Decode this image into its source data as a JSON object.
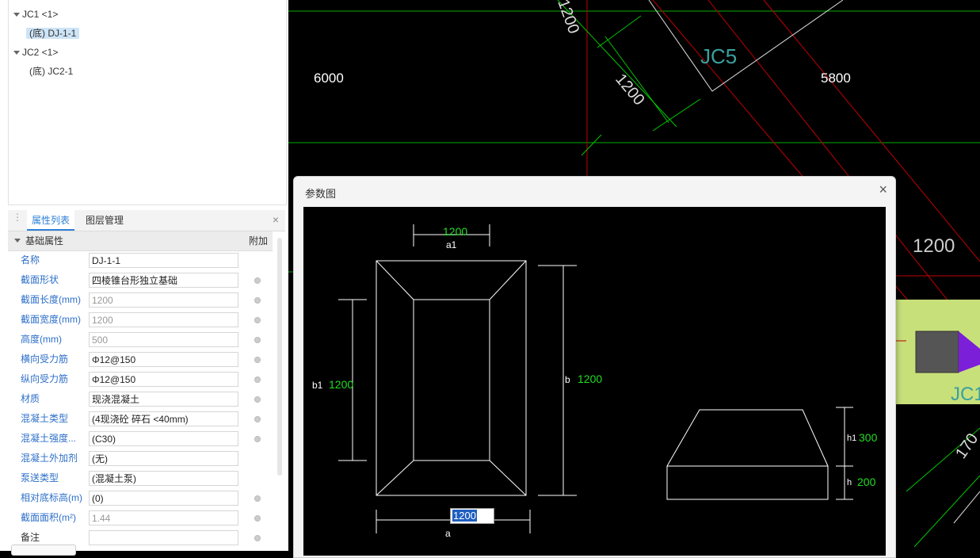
{
  "tree": {
    "items": [
      {
        "label": "JC1 <1>",
        "children": [
          {
            "label": "(底) DJ-1-1",
            "selected": true
          }
        ]
      },
      {
        "label": "JC2 <1>",
        "children": [
          {
            "label": "(底) JC2-1",
            "selected": false
          }
        ]
      }
    ]
  },
  "tabs": [
    {
      "label": "属性列表",
      "active": true
    },
    {
      "label": "图层管理",
      "active": false
    }
  ],
  "props": {
    "group": "基础属性",
    "extra_header": "附加",
    "rows": [
      {
        "name": "名称",
        "value": "DJ-1-1",
        "dim": false,
        "dot": false
      },
      {
        "name": "截面形状",
        "value": "四棱锥台形独立基础",
        "dim": false,
        "dot": true
      },
      {
        "name": "截面长度(mm)",
        "value": "1200",
        "dim": true,
        "dot": true
      },
      {
        "name": "截面宽度(mm)",
        "value": "1200",
        "dim": true,
        "dot": true
      },
      {
        "name": "高度(mm)",
        "value": "500",
        "dim": true,
        "dot": true
      },
      {
        "name": "横向受力筋",
        "value": "Φ12@150",
        "dim": false,
        "dot": true
      },
      {
        "name": "纵向受力筋",
        "value": "Φ12@150",
        "dim": false,
        "dot": true
      },
      {
        "name": "材质",
        "value": "现浇混凝土",
        "dim": false,
        "dot": true
      },
      {
        "name": "混凝土类型",
        "value": "(4现浇砼 碎石 <40mm)",
        "dim": false,
        "dot": true
      },
      {
        "name": "混凝土强度...",
        "value": "(C30)",
        "dim": false,
        "dot": true
      },
      {
        "name": "混凝土外加剂",
        "value": "(无)",
        "dim": false,
        "dot": false
      },
      {
        "name": "泵送类型",
        "value": "(混凝土泵)",
        "dim": false,
        "dot": false
      },
      {
        "name": "相对底标高(m)",
        "value": "(0)",
        "dim": false,
        "dot": true
      },
      {
        "name": "截面面积(m²)",
        "value": "1.44",
        "dim": true,
        "dot": true
      },
      {
        "name": "备注",
        "value": "",
        "dim": false,
        "dot": true
      }
    ]
  },
  "cad": {
    "dim_6000": "6000",
    "dim_5800": "5800",
    "dim_1200_top": "1200",
    "dim_1200_mid": "1200",
    "dim_1200_right": "1200",
    "label_jc5": "JC5",
    "label_jc1": "JC1",
    "label_170": "170"
  },
  "dialog": {
    "title": "参数图",
    "close": "×",
    "a1_value": "1200",
    "a1_label": "a1",
    "b1_label": "b1",
    "b1_value": "1200",
    "b_label": "b",
    "b_value": "1200",
    "a_value": "1200",
    "a_label": "a",
    "h1_label": "h1",
    "h1_value": "300",
    "h_label": "h",
    "h_value": "200"
  },
  "colors": {
    "accent": "#2e7fd6",
    "cad_green": "#00c800",
    "cad_red": "#d00000",
    "label_green": "#22dd22"
  }
}
